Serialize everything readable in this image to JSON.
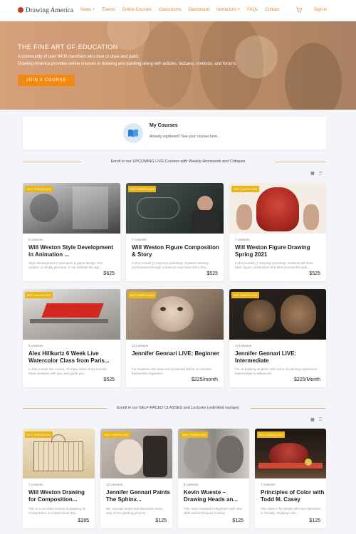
{
  "brand": {
    "name": "Drawing America"
  },
  "nav": {
    "items": [
      {
        "label": "News",
        "has_dropdown": true
      },
      {
        "label": "Events"
      },
      {
        "label": "Online Courses"
      },
      {
        "label": "Classrooms"
      },
      {
        "label": "Dashboard"
      },
      {
        "label": "Instructors",
        "has_dropdown": true
      },
      {
        "label": "FAQs"
      },
      {
        "label": "Contact"
      }
    ],
    "cart_icon": "cart-icon",
    "signin": "Sign in"
  },
  "hero": {
    "title": "THE FINE ART OF EDUCATION",
    "line1": "A community of over 9400 members who love to draw and paint.",
    "line2": "Drawing America provides online courses in drawing and painting along with articles, lectures, contests, and forums.",
    "button": "JOIN A COURSE"
  },
  "my_courses": {
    "title": "My Courses",
    "subtitle": "Already registered? See your courses here...",
    "icon": "book-icon"
  },
  "upcoming": {
    "heading": "Enroll in our UPCOMING LIVE Courses with Weekly Homework and Critiques",
    "courses": [
      {
        "badge": "NOT ENROLLED",
        "lessons": "8 Lessons",
        "title": "Will Weston Style Development in Animation ...",
        "desc": "Style development in animation & game design: let's random or simply personal. It can indicate the age...",
        "price": "$625"
      },
      {
        "badge": "NOT ENROLLED",
        "lessons": "7 Lessons",
        "title": "Will Weston Figure Composition & Story",
        "desc": "In this 6-week (7 lessons) workshop, students develop proficiencies through numerous exercises and a fina...",
        "price": "$525"
      },
      {
        "badge": "NOT ENROLLED",
        "lessons": "7 Lessons",
        "title": "Will Weston Figure Drawing Spring 2021",
        "desc": "In this 6-week (7 lessons) workshop, students will learn basic figure construction and then proceed through...",
        "price": "$525"
      },
      {
        "badge": "NOT ENROLLED",
        "lessons": "6 Lessons",
        "title": "Alex Hillkurtz 6 Week Live Watercolor Class from Paris...",
        "desc": "In this 6 week live course, I'll share some of my favorite Paris locations with you, and guide you...",
        "price": "$525"
      },
      {
        "badge": "NOT ENROLLED",
        "lessons": "13 Lessons",
        "title": "Jennifer Gennari LIVE: Beginner",
        "desc": "For students who have not oil painted before or consider themselves beginners.",
        "price": "$225/month"
      },
      {
        "badge": "NOT ENROLLED",
        "lessons": "14 Lessons",
        "title": "Jennifer Gennari LIVE: Intermediate",
        "desc": "For oil painting students with some oil painting experience: intermediate to advanced.",
        "price": "$225/Month"
      }
    ]
  },
  "self_paced": {
    "heading": "Enroll in our SELF-PACED CLASSES and Lectures (unlimited replays)",
    "courses": [
      {
        "badge": "NOT ENROLLED",
        "lessons": "7 Lessons",
        "title": "Will Weston Drawing for Composition...",
        "desc": "This is a recorded version of Drawing for Composition, a 6-week class that...",
        "price": "$285"
      },
      {
        "badge": "NOT ENROLLED",
        "lessons": "12 Lessons",
        "title": "Jennifer Gennari Paints The Sphinx...",
        "desc": "Ms. Gennari paints and discusses every step of her painting process...",
        "price": "$125"
      },
      {
        "badge": "NOT ENROLLED",
        "lessons": "6 Lessons",
        "title": "Kevin Wueste – Drawing Heads an...",
        "desc": "This class empowers beginners with new skills and techniques to draw...",
        "price": "$125"
      },
      {
        "badge": "NOT ENROLLED",
        "lessons": "7 Lessons",
        "title": "Principles of Color with Todd M. Casey",
        "desc": "This class is for people who are interested in formally 'studying' colo...",
        "price": "$125"
      }
    ]
  },
  "colors": {
    "accent": "#f28a12",
    "badge": "#e9b616",
    "link": "#e8821e"
  }
}
